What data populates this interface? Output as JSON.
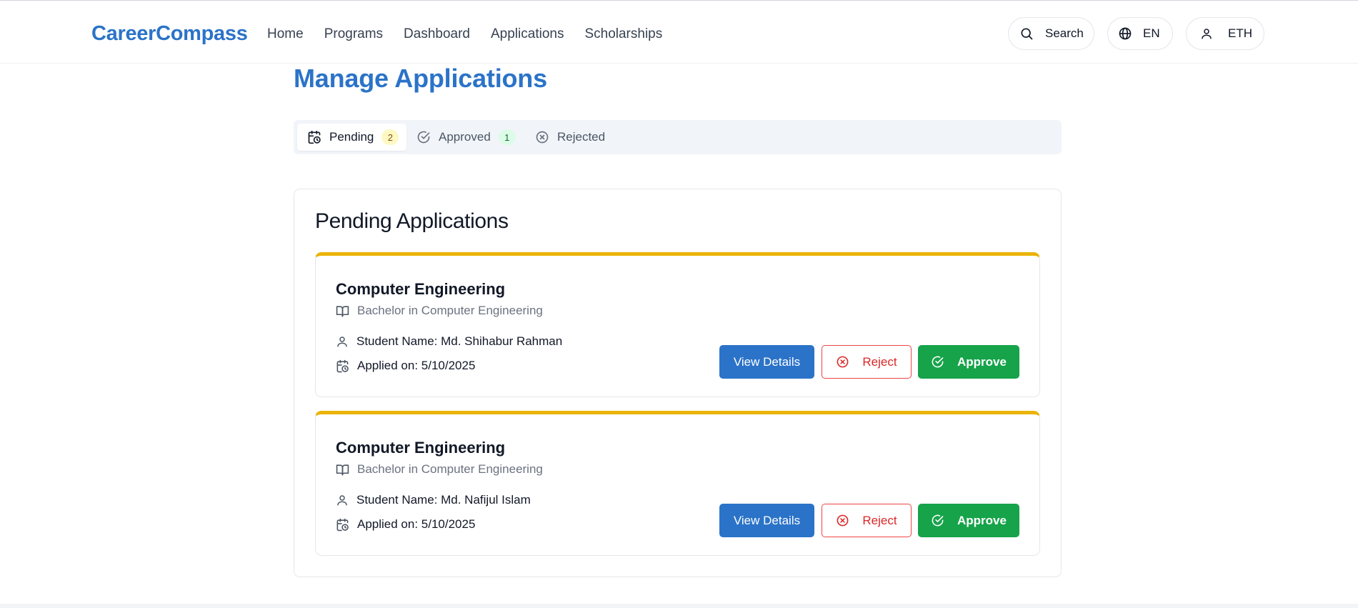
{
  "header": {
    "logo": "CareerCompass",
    "nav": [
      "Home",
      "Programs",
      "Dashboard",
      "Applications",
      "Scholarships"
    ],
    "search_label": "Search",
    "language_label": "EN",
    "user_label": "ETH"
  },
  "page": {
    "title": "Manage Applications"
  },
  "tabs": [
    {
      "label": "Pending",
      "count": "2",
      "icon": "calendar-clock-icon",
      "active": true
    },
    {
      "label": "Approved",
      "count": "1",
      "icon": "check-circle-icon",
      "active": false
    },
    {
      "label": "Rejected",
      "icon": "x-circle-icon",
      "active": false
    }
  ],
  "panel": {
    "title": "Pending Applications",
    "applications": [
      {
        "program": "Computer Engineering",
        "degree": "Bachelor in Computer Engineering",
        "student": "Student Name: Md. Shihabur Rahman",
        "applied": "Applied on: 5/10/2025"
      },
      {
        "program": "Computer Engineering",
        "degree": "Bachelor in Computer Engineering",
        "student": "Student Name: Md. Nafijul Islam",
        "applied": "Applied on: 5/10/2025"
      }
    ],
    "buttons": {
      "view": "View Details",
      "reject": "Reject",
      "approve": "Approve"
    }
  },
  "colors": {
    "brand": "#2b73c8",
    "pending_accent": "#eab308",
    "approve": "#16a34a",
    "reject": "#dc2626"
  }
}
